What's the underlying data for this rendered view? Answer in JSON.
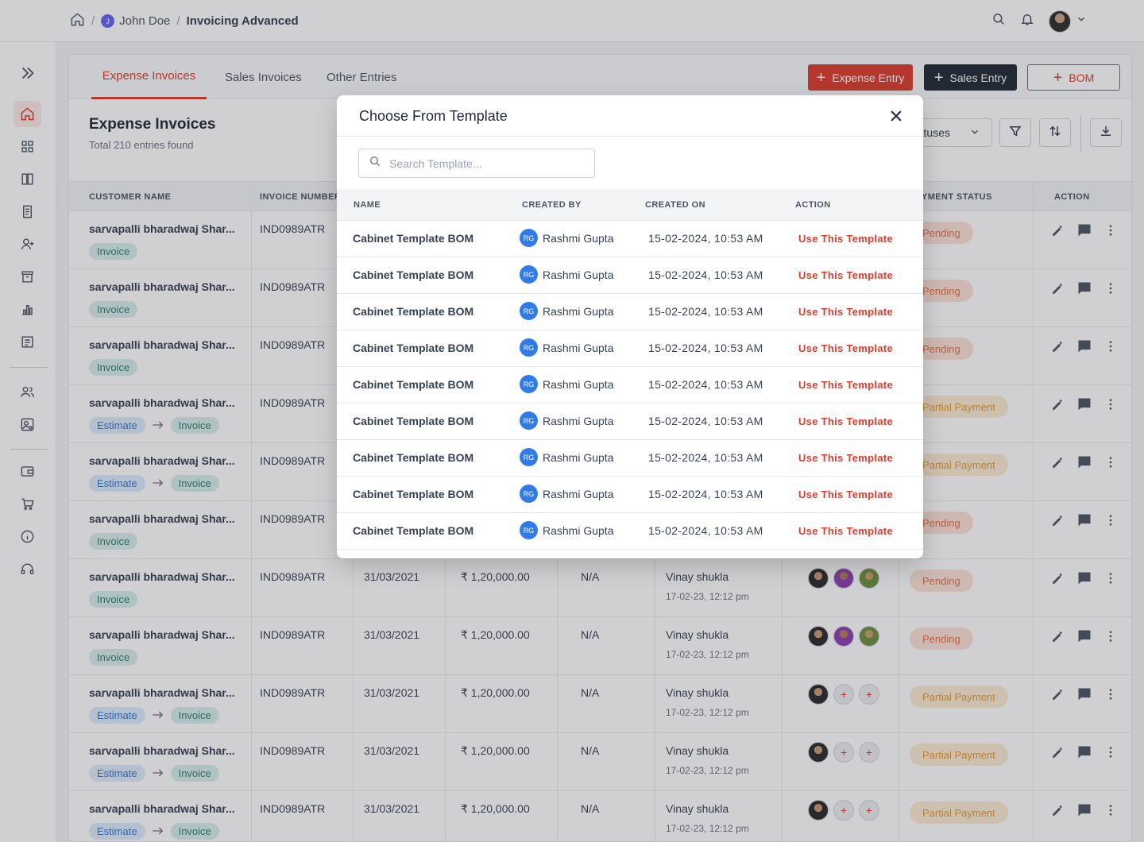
{
  "breadcrumb": {
    "user_initial": "J",
    "user_name": "John Doe",
    "current": "Invoicing Advanced"
  },
  "tabs": [
    "Expense Invoices",
    "Sales Invoices",
    "Other Entries"
  ],
  "actions": {
    "expense_entry": "Expense Entry",
    "sales_entry": "Sales Entry",
    "bom": "BOM"
  },
  "page": {
    "title": "Expense Invoices",
    "subtitle": "Total 210 entries found",
    "status_filter": "atuses"
  },
  "table": {
    "headers": [
      "CUSTOMER NAME",
      "INVOICE NUMBER",
      "YMENT STATUS",
      "ACTION"
    ],
    "rows": [
      {
        "customer": "sarvapalli bharadwaj Shar...",
        "estimate": "",
        "invoice": "Invoice",
        "number": "IND0989ATR",
        "date": "",
        "amount": "",
        "due": "",
        "creator": "",
        "created": "",
        "status": "Pending",
        "status_type": "pending",
        "avatars": "none"
      },
      {
        "customer": "sarvapalli bharadwaj Shar...",
        "estimate": "",
        "invoice": "Invoice",
        "number": "IND0989ATR",
        "date": "",
        "amount": "",
        "due": "",
        "creator": "",
        "created": "",
        "status": "Pending",
        "status_type": "pending",
        "avatars": "none"
      },
      {
        "customer": "sarvapalli bharadwaj Shar...",
        "estimate": "",
        "invoice": "Invoice",
        "number": "IND0989ATR",
        "date": "",
        "amount": "",
        "due": "",
        "creator": "",
        "created": "",
        "status": "Pending",
        "status_type": "pending",
        "avatars": "none"
      },
      {
        "customer": "sarvapalli bharadwaj Shar...",
        "estimate": "Estimate",
        "invoice": "Invoice",
        "number": "IND0989ATR",
        "date": "",
        "amount": "",
        "due": "",
        "creator": "",
        "created": "",
        "status": "Partial Payment",
        "status_type": "partial",
        "avatars": "none"
      },
      {
        "customer": "sarvapalli bharadwaj Shar...",
        "estimate": "Estimate",
        "invoice": "Invoice",
        "number": "IND0989ATR",
        "date": "",
        "amount": "",
        "due": "",
        "creator": "",
        "created": "",
        "status": "Partial Payment",
        "status_type": "partial",
        "avatars": "none"
      },
      {
        "customer": "sarvapalli bharadwaj Shar...",
        "estimate": "",
        "invoice": "Invoice",
        "number": "IND0989ATR",
        "date": "",
        "amount": "",
        "due": "",
        "creator": "",
        "created": "",
        "status": "Pending",
        "status_type": "pending",
        "avatars": "none"
      },
      {
        "customer": "sarvapalli bharadwaj Shar...",
        "estimate": "",
        "invoice": "Invoice",
        "number": "IND0989ATR",
        "date": "31/03/2021",
        "amount": "₹ 1,20,000.00",
        "due": "N/A",
        "creator": "Vinay shukla",
        "created": "17-02-23, 12:12 pm",
        "status": "Pending",
        "status_type": "pending",
        "avatars": "photos"
      },
      {
        "customer": "sarvapalli bharadwaj Shar...",
        "estimate": "",
        "invoice": "Invoice",
        "number": "IND0989ATR",
        "date": "31/03/2021",
        "amount": "₹ 1,20,000.00",
        "due": "N/A",
        "creator": "Vinay shukla",
        "created": "17-02-23, 12:12 pm",
        "status": "Pending",
        "status_type": "pending",
        "avatars": "photos"
      },
      {
        "customer": "sarvapalli bharadwaj Shar...",
        "estimate": "Estimate",
        "invoice": "Invoice",
        "number": "IND0989ATR",
        "date": "31/03/2021",
        "amount": "₹ 1,20,000.00",
        "due": "N/A",
        "creator": "Vinay shukla",
        "created": "17-02-23, 12:12 pm",
        "status": "Partial Payment",
        "status_type": "partial",
        "avatars": "add"
      },
      {
        "customer": "sarvapalli bharadwaj Shar...",
        "estimate": "Estimate",
        "invoice": "Invoice",
        "number": "IND0989ATR",
        "date": "31/03/2021",
        "amount": "₹ 1,20,000.00",
        "due": "N/A",
        "creator": "Vinay shukla",
        "created": "17-02-23, 12:12 pm",
        "status": "Partial Payment",
        "status_type": "partial",
        "avatars": "add"
      },
      {
        "customer": "sarvapalli bharadwaj Shar...",
        "estimate": "Estimate",
        "invoice": "Invoice",
        "number": "IND0989ATR",
        "date": "31/03/2021",
        "amount": "₹ 1,20,000.00",
        "due": "N/A",
        "creator": "Vinay shukla",
        "created": "17-02-23, 12:12 pm",
        "status": "Partial Payment",
        "status_type": "partial",
        "avatars": "add"
      }
    ]
  },
  "modal": {
    "title": "Choose From Template",
    "search_placeholder": "Search Template...",
    "headers": [
      "NAME",
      "CREATED BY",
      "CREATED ON",
      "ACTION"
    ],
    "rows": [
      {
        "name": "Cabinet Template BOM",
        "initials": "RG",
        "by": "Rashmi Gupta",
        "on": "15-02-2024, 10:53 AM",
        "action": "Use This Template"
      },
      {
        "name": "Cabinet Template BOM",
        "initials": "RG",
        "by": "Rashmi Gupta",
        "on": "15-02-2024, 10:53 AM",
        "action": "Use This Template"
      },
      {
        "name": "Cabinet Template BOM",
        "initials": "RG",
        "by": "Rashmi Gupta",
        "on": "15-02-2024, 10:53 AM",
        "action": "Use This Template"
      },
      {
        "name": "Cabinet Template BOM",
        "initials": "RG",
        "by": "Rashmi Gupta",
        "on": "15-02-2024, 10:53 AM",
        "action": "Use This Template"
      },
      {
        "name": "Cabinet Template BOM",
        "initials": "RG",
        "by": "Rashmi Gupta",
        "on": "15-02-2024, 10:53 AM",
        "action": "Use This Template"
      },
      {
        "name": "Cabinet Template BOM",
        "initials": "RG",
        "by": "Rashmi Gupta",
        "on": "15-02-2024, 10:53 AM",
        "action": "Use This Template"
      },
      {
        "name": "Cabinet Template BOM",
        "initials": "RG",
        "by": "Rashmi Gupta",
        "on": "15-02-2024, 10:53 AM",
        "action": "Use This Template"
      },
      {
        "name": "Cabinet Template BOM",
        "initials": "RG",
        "by": "Rashmi Gupta",
        "on": "15-02-2024, 10:53 AM",
        "action": "Use This Template"
      },
      {
        "name": "Cabinet Template BOM",
        "initials": "RG",
        "by": "Rashmi Gupta",
        "on": "15-02-2024, 10:53 AM",
        "action": "Use This Template"
      }
    ]
  },
  "colors": {
    "brand": "#dc3d2e",
    "dark": "#1f2937",
    "pending": "#e46f47",
    "partial": "#e59a33",
    "avatar_blue": "#2f7be8"
  },
  "icons": [
    "home-icon",
    "search-icon",
    "bell-icon",
    "chevron-down-icon",
    "expand-icon",
    "plus-icon",
    "filter-icon",
    "sort-icon",
    "download-icon",
    "close-icon",
    "edit-icon",
    "comment-icon",
    "more-icon",
    "arrow-right-icon"
  ]
}
